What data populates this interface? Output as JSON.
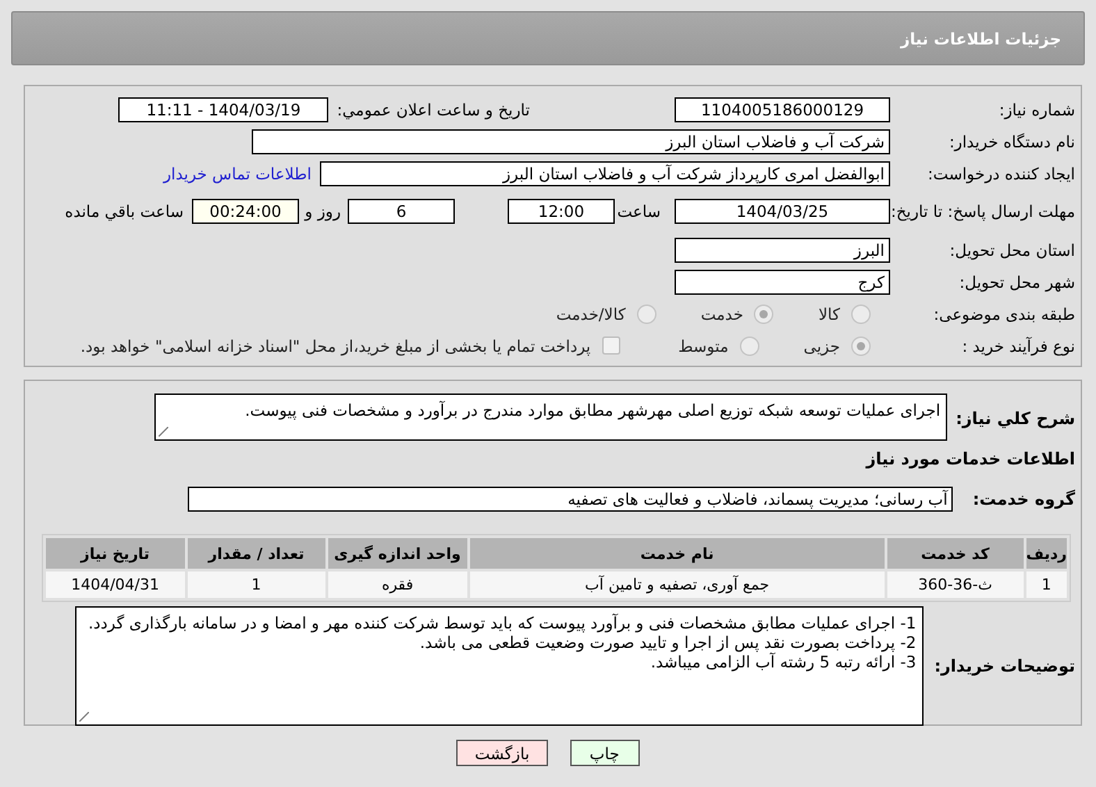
{
  "header": {
    "title": "جزئیات اطلاعات نیاز"
  },
  "details": {
    "need_number": {
      "label": "شماره نیاز:",
      "value": "1104005186000129"
    },
    "announce": {
      "label": "تاریخ و ساعت اعلان عمومي:",
      "value": "1404/03/19 - 11:11"
    },
    "buyer": {
      "label": "نام دستگاه خریدار:",
      "value": "شرکت آب و فاضلاب استان البرز"
    },
    "creator": {
      "label": "ایجاد کننده درخواست:",
      "value": "ابوالفضل امری کارپرداز شرکت آب و فاضلاب استان البرز",
      "link": "اطلاعات تماس خریدار"
    },
    "deadline": {
      "label": "مهلت ارسال پاسخ: تا تاریخ:",
      "date": "1404/03/25",
      "time_label": "ساعت",
      "time": "12:00",
      "days": "6",
      "days_label": "روز و",
      "remaining": "00:24:00",
      "remaining_label": "ساعت باقي مانده"
    },
    "province": {
      "label": "استان محل تحویل:",
      "value": "البرز"
    },
    "city": {
      "label": "شهر محل تحویل:",
      "value": "کرج"
    },
    "category": {
      "label": "طبقه بندی موضوعی:",
      "options": [
        {
          "label": "کالا",
          "selected": false
        },
        {
          "label": "خدمت",
          "selected": true
        },
        {
          "label": "کالا/خدمت",
          "selected": false
        }
      ]
    },
    "process": {
      "label": "نوع فرآیند خرید :",
      "options": [
        {
          "label": "جزیی",
          "selected": true
        },
        {
          "label": "متوسط",
          "selected": false
        }
      ],
      "treasury": {
        "label": "پرداخت تمام یا بخشی از مبلغ خرید،از محل \"اسناد خزانه اسلامی\" خواهد بود.",
        "checked": false
      }
    }
  },
  "need": {
    "description": {
      "label": "شرح کلي نیاز:",
      "value": "اجرای عملیات توسعه شبکه توزیع اصلی مهرشهر مطابق موارد مندرج در برآورد و مشخصات فنی پیوست."
    },
    "section_title": "اطلاعات خدمات مورد نیاز",
    "service_group": {
      "label": "گروه خدمت:",
      "value": "آب رسانی؛ مدیریت پسماند، فاضلاب و فعالیت های تصفیه"
    },
    "table": {
      "columns": [
        "ردیف",
        "کد خدمت",
        "نام خدمت",
        "واحد اندازه گیری",
        "تعداد / مقدار",
        "تاریخ نیاز"
      ],
      "rows": [
        [
          "1",
          "ث-36-360",
          "جمع آوری، تصفیه و تامین آب",
          "فقره",
          "1",
          "1404/04/31"
        ]
      ]
    },
    "buyer_notes": {
      "label": "توضیحات خریدار:",
      "lines": [
        "1- اجرای عملیات مطابق مشخصات فنی و برآورد پیوست که باید توسط شرکت کننده مهر و امضا و در سامانه بارگذاری گردد.",
        "2- پرداخت بصورت نقد پس از اجرا و تایید صورت وضعیت قطعی می باشد.",
        "3- ارائه رتبه 5 رشته آب الزامی میباشد."
      ]
    }
  },
  "buttons": [
    {
      "label": "چاپ",
      "kind": "print"
    },
    {
      "label": "بازگشت",
      "kind": "back"
    }
  ]
}
